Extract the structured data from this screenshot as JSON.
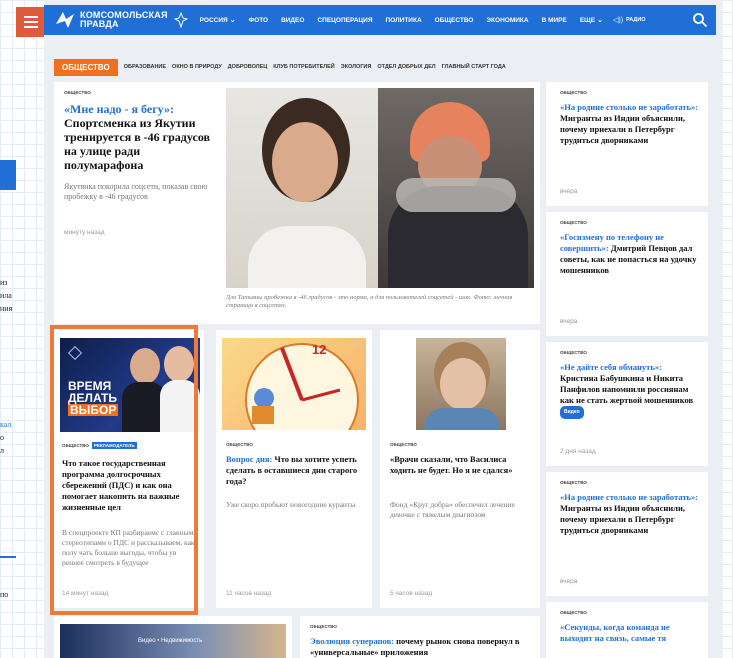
{
  "header": {
    "logo_line1": "Комсомольская",
    "logo_line2": "правда",
    "nav": [
      "Россия",
      "Фото",
      "Видео",
      "Спецоперация",
      "Политика",
      "Общество",
      "Экономика",
      "В мире",
      "Еще"
    ],
    "radio": "Радио",
    "accent": "#1f6fd6"
  },
  "rubric": {
    "main": "Общество",
    "subs": [
      "Образование",
      "Окно в природу",
      "Доброволец",
      "Клуб потребителей",
      "Экология",
      "Отдел добрых дел",
      "Главный старт года"
    ],
    "accent": "#f0701e"
  },
  "lead_story": {
    "tag": "общество",
    "title_quote": "«Мне надо - я бегу»:",
    "title_rest": "Спортсменка из Якутии тренируется в -46 градусов на улице ради полумарафона",
    "lead": "Якутянка покорила соцсети, показав свою пробежку в -46 градусов",
    "when": "минуту назад",
    "photo_caption": "Для Татьяны пробежка в -46 градусов - это норма, а для пользователей соцсетей - шок. Фото: личная страница в соцсетях."
  },
  "promo": {
    "tag": "общество",
    "badge": "Рекламодатель",
    "image_text_1": "ВРЕМЯ",
    "image_text_2": "ДЕЛАТЬ",
    "image_text_3": "ВЫБОР",
    "title": "Что такое государственная программа долгосрочных сбережений (ПДС) и как она помогает накопить на важные жизненные цел",
    "lead": "В спецпроекте КП разбираемс с главными стереотипами о ПДС и рассказываем, как полу чать больше выгоды, чтобы ув реннее смотреть в будущее",
    "when": "14 минут назад"
  },
  "clock_story": {
    "tag": "общество",
    "title_blue": "Вопрос дня:",
    "title_rest": "Что вы хотите успеть сделать в оставшиеся дни старого года?",
    "lead": "Уже скоро пробьют новогодние куранты",
    "when": "11 часов назад",
    "clock_number": "12"
  },
  "girl_story": {
    "tag": "общество",
    "title": "«Врачи сказали, что Василиса ходить не будет. Но я не сдался»",
    "lead": "Фонд «Круг добра» обеспечил лечение девочке с тяжелым диагнозом",
    "when": "5 часов назад"
  },
  "bottom_story": {
    "tag": "общество",
    "title_blue": "Эволюция суперапов:",
    "title_rest": "почему рынок снова повернул в «универсальные» приложения",
    "img_label": "Видео • Недвижимость"
  },
  "sidebar": [
    {
      "tag": "общество",
      "title_blue": "«На родине столько не заработать»:",
      "title_rest": "Мигранты из Индии объяснили, почему приехали в Петербург трудиться дворниками",
      "when": "вчера"
    },
    {
      "tag": "общество",
      "title_blue": "«Госизмену по телефону не совершить»:",
      "title_rest": "Дмитрий Певцов дал советы, как не попасться на удочку мошенников",
      "when": "вчера"
    },
    {
      "tag": "общество",
      "title_blue": "«Не дайте себя обмануть»:",
      "title_rest": "Кристина Бабушкина и Никита Панфилов напомнили россиянам как не стать жертвой мошенников",
      "video": "Видео",
      "when": "2 дня назад"
    },
    {
      "tag": "общество",
      "title_blue": "«На родине столько не заработать»:",
      "title_rest": "Мигранты из Индии объяснили, почему приехали в Петербург трудиться дворниками",
      "when": "вчера"
    },
    {
      "tag": "общество",
      "title_blue": "«Секунды, когда команда не выходит на связь, самые тя",
      "title_rest": ""
    }
  ],
  "left_fragments": [
    "из",
    "ила",
    "ния",
    "кал",
    "о",
    "л",
    "по"
  ]
}
